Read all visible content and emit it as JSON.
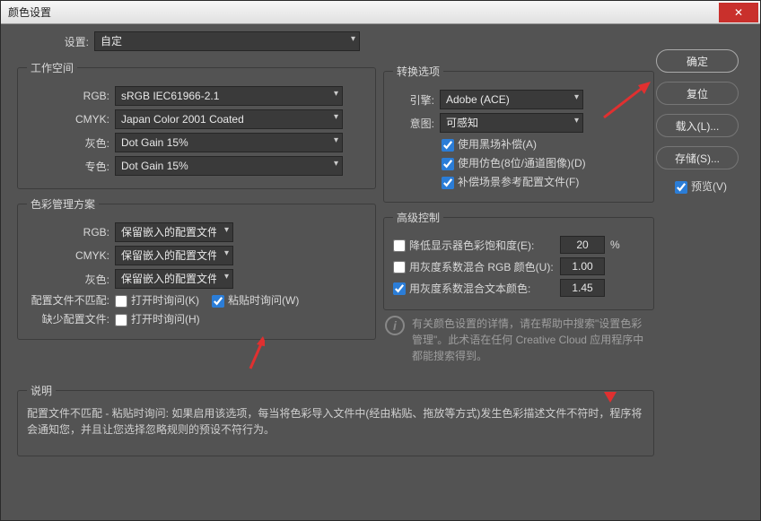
{
  "title": "颜色设置",
  "settings": {
    "label": "设置:",
    "value": "自定"
  },
  "workspace": {
    "legend": "工作空间",
    "rgb_label": "RGB:",
    "rgb_value": "sRGB IEC61966-2.1",
    "cmyk_label": "CMYK:",
    "cmyk_value": "Japan Color 2001 Coated",
    "gray_label": "灰色:",
    "gray_value": "Dot Gain 15%",
    "spot_label": "专色:",
    "spot_value": "Dot Gain 15%"
  },
  "policy": {
    "legend": "色彩管理方案",
    "rgb_label": "RGB:",
    "rgb_value": "保留嵌入的配置文件",
    "cmyk_label": "CMYK:",
    "cmyk_value": "保留嵌入的配置文件",
    "gray_label": "灰色:",
    "gray_value": "保留嵌入的配置文件",
    "mismatch_label": "配置文件不匹配:",
    "ask_open": "打开时询问(K)",
    "ask_paste": "粘贴时询问(W)",
    "missing_label": "缺少配置文件:",
    "ask_open_missing": "打开时询问(H)"
  },
  "convert": {
    "legend": "转换选项",
    "engine_label": "引擎:",
    "engine_value": "Adobe (ACE)",
    "intent_label": "意图:",
    "intent_value": "可感知",
    "black_point": "使用黑场补偿(A)",
    "dither": "使用仿色(8位/通道图像)(D)",
    "scene_ref": "补偿场景参考配置文件(F)"
  },
  "advanced": {
    "legend": "高级控制",
    "desat_label": "降低显示器色彩饱和度(E):",
    "desat_value": "20",
    "desat_unit": "%",
    "blend_rgb_label": "用灰度系数混合 RGB 颜色(U):",
    "blend_rgb_value": "1.00",
    "blend_text_label": "用灰度系数混合文本颜色:",
    "blend_text_value": "1.45"
  },
  "info_text": "有关颜色设置的详情，请在帮助中搜索\"设置色彩管理\"。此术语在任何 Creative Cloud 应用程序中都能搜索得到。",
  "desc": {
    "legend": "说明",
    "text": "配置文件不匹配 - 粘贴时询问: 如果启用该选项，每当将色彩导入文件中(经由粘贴、拖放等方式)发生色彩描述文件不符时，程序将会通知您，并且让您选择忽略规则的预设不符行为。"
  },
  "buttons": {
    "ok": "确定",
    "reset": "复位",
    "load": "载入(L)...",
    "save": "存储(S)...",
    "preview": "预览(V)"
  }
}
